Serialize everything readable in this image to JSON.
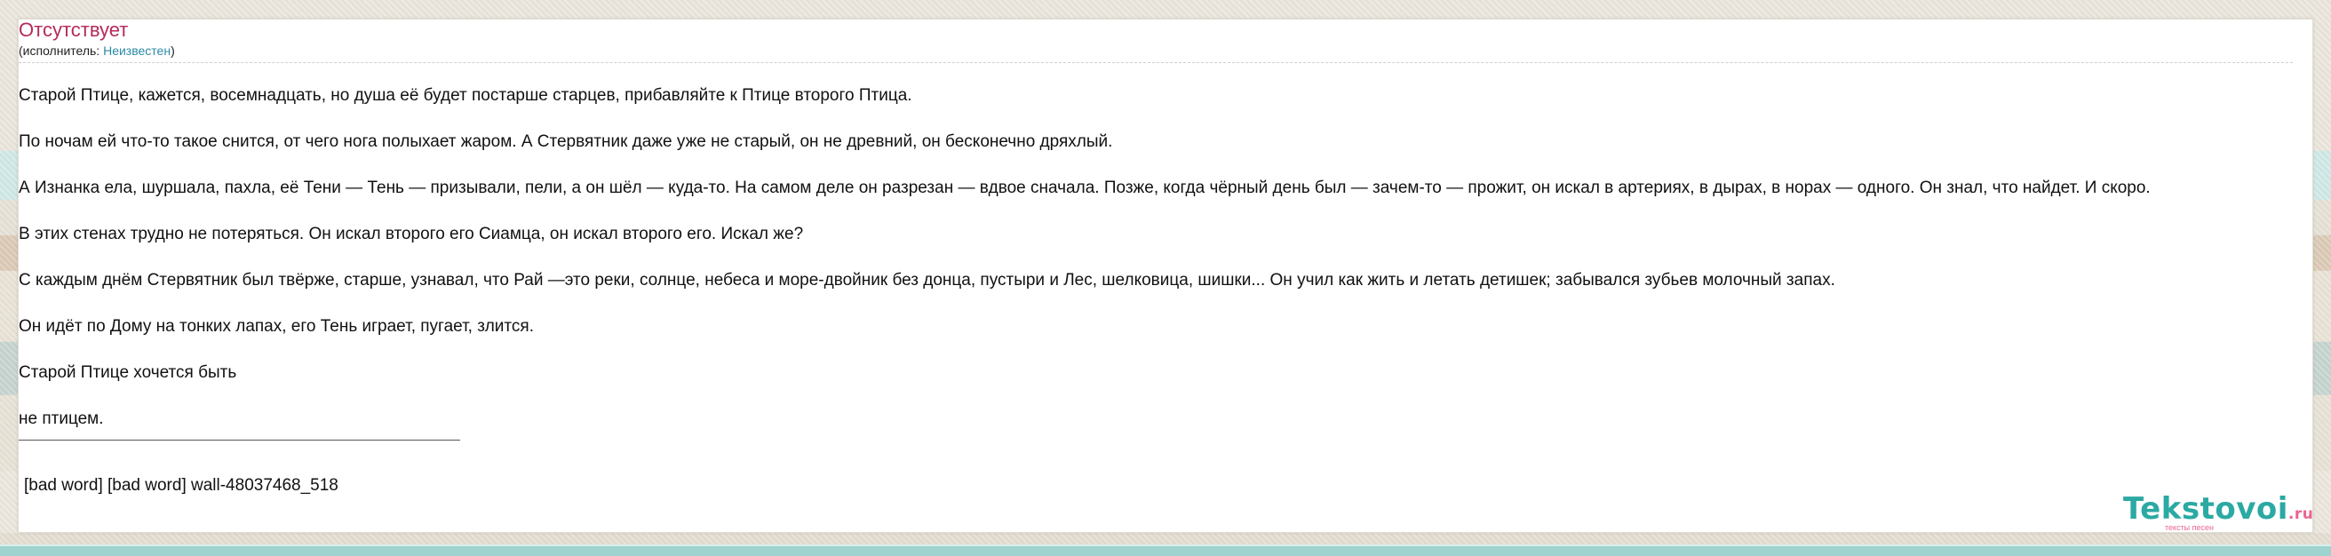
{
  "song": {
    "title": "Отсутствует",
    "artist_prefix": "(исполнитель: ",
    "artist": "Неизвестен",
    "artist_suffix": ")"
  },
  "lyrics": [
    "Старой Птице, кажется, восемнадцать, но душа её будет постарше старцев, прибавляйте к Птице второго Птица.",
    "По ночам ей что-то такое снится, от чего нога полыхает жаром. А Стервятник даже уже не старый, он не древний, он бесконечно дряхлый.",
    "А Изнанка ела, шуршала, пахла, её Тени — Тень — призывали, пели, а он шёл — куда-то. На самом деле он разрезан — вдвое сначала. Позже, когда чёрный день был — зачем-то — прожит, он искал в артериях, в дырах, в норах — одного. Он знал, что найдет. И скоро.",
    "В этих стенах трудно не потеряться. Он искал второго его Сиамца, он искал второго его. Искал же?",
    "С каждым днём Стервятник был твёрже, старше, узнавал, что Рай —это реки, солнце, небеса и море-двойник без донца, пустыри и Лес, шелковица, шишки... Он учил как жить и летать детишек; забывался зубьев молочный запах.",
    "Он идёт по Дому на тонких лапах, его Тень играет, пугает, злится.",
    "Старой Птице хочется быть",
    "не птицем."
  ],
  "footer": {
    "text": "[bad word]  [bad word] wall-48037468_518"
  },
  "logo": {
    "name": "Tekstovoi",
    "suffix": ".ru",
    "tagline": "тексты песен"
  },
  "colors": {
    "title": "#b52a5c",
    "link": "#2c8aa6",
    "logo": "#2ba9a3",
    "logo_accent": "#e96590"
  }
}
